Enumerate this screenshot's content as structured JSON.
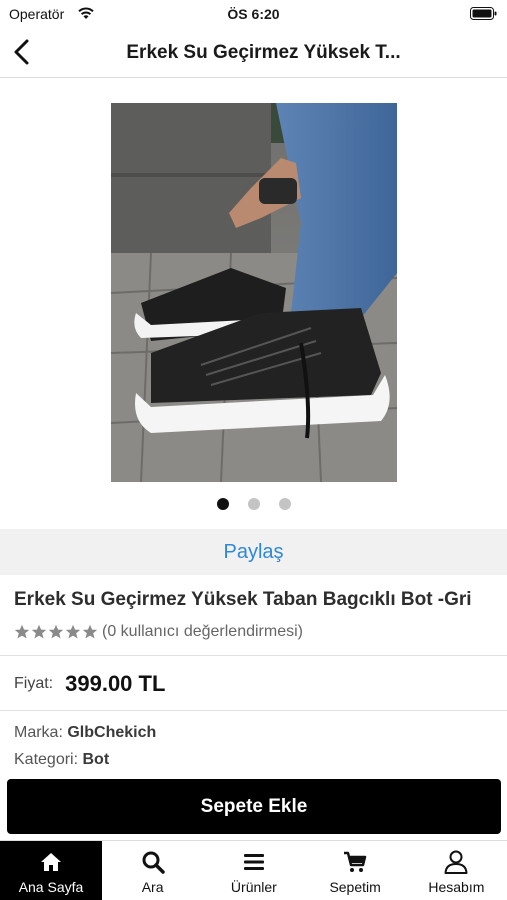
{
  "status_bar": {
    "carrier": "Operatör",
    "time": "ÖS 6:20"
  },
  "nav": {
    "title": "Erkek Su Geçirmez Yüksek T..."
  },
  "gallery": {
    "image_count": 3,
    "active_index": 0
  },
  "share": {
    "label": "Paylaş"
  },
  "product": {
    "title": "Erkek Su Geçirmez Yüksek Taban Bagcıklı Bot -Gri",
    "rating_stars": 5,
    "rating_value": 0,
    "rating_text": "(0 kullanıcı değerlendirmesi)",
    "price_label": "Fiyat:",
    "price_value": "399.00 TL",
    "brand_label": "Marka:",
    "brand_value": "GlbChekich",
    "category_label": "Kategori:",
    "category_value": "Bot"
  },
  "cart": {
    "add_label": "Sepete Ekle"
  },
  "tab_bar": {
    "tabs": [
      {
        "label": "Ana Sayfa",
        "icon": "home-icon",
        "active": true
      },
      {
        "label": "Ara",
        "icon": "search-icon",
        "active": false
      },
      {
        "label": "Ürünler",
        "icon": "menu-icon",
        "active": false
      },
      {
        "label": "Sepetim",
        "icon": "cart-icon",
        "active": false
      },
      {
        "label": "Hesabım",
        "icon": "user-icon",
        "active": false
      }
    ]
  },
  "colors": {
    "accent": "#2e88d8",
    "button_bg": "#000000",
    "star": "#8a8a8a"
  }
}
